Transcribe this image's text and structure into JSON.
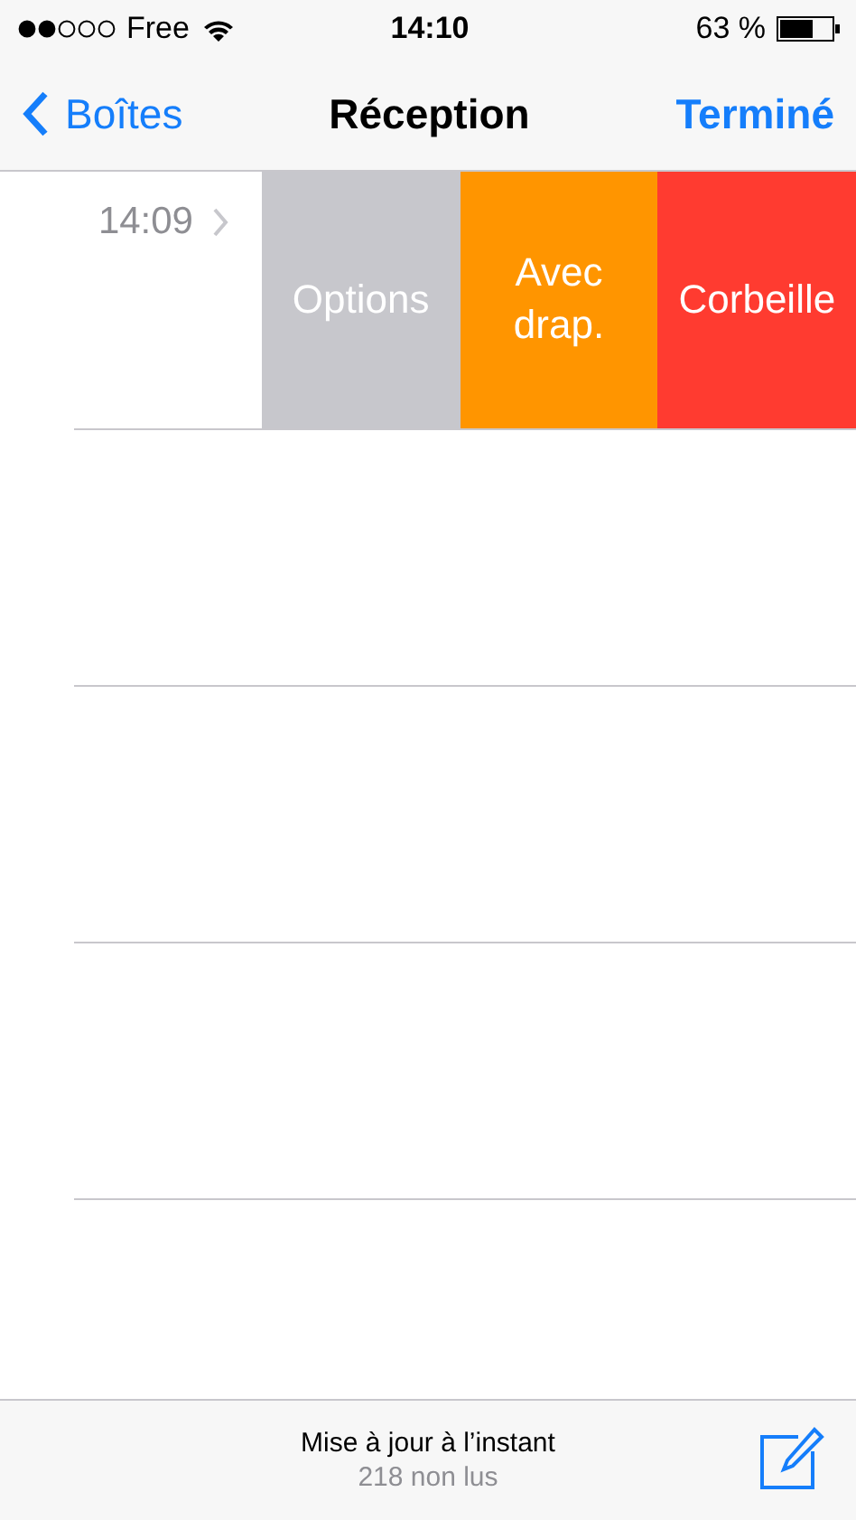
{
  "status_bar": {
    "carrier": "Free",
    "time": "14:10",
    "battery": "63 %"
  },
  "nav": {
    "back": "Boîtes",
    "title": "Réception",
    "action": "Terminé"
  },
  "messages": [
    {
      "time": "14:09",
      "actions": [
        {
          "label": "Options",
          "color": "#c7c7cc"
        },
        {
          "label": "Avec\ndrap.",
          "color": "#ff9500"
        },
        {
          "label": "Corbeille",
          "color": "#ff3b30"
        }
      ]
    }
  ],
  "toolbar": {
    "status": "Mise à jour à l’instant",
    "unread": "218 non lus"
  }
}
